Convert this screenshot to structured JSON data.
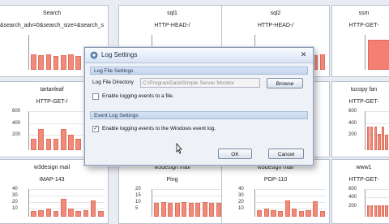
{
  "panels": [
    {
      "title": "Search",
      "subtitle": "&search_adv=0&search_size=&search_s",
      "ticks": [],
      "values": [
        0.45,
        0.42,
        0.44,
        0.4,
        0.42,
        0.45,
        0.4,
        0.44,
        0.42,
        0.43
      ]
    },
    {
      "title": "sql1",
      "subtitle": "HTTP-HEAD-/",
      "ticks": [],
      "values": [
        0.45,
        0.43,
        0.45,
        0.44,
        0.45,
        0.43,
        0.44,
        0.45,
        0.44,
        0.45
      ]
    },
    {
      "title": "sql2",
      "subtitle": "HTTP-HEAD-/",
      "ticks": [],
      "values": [
        0.45,
        0.43,
        0.42,
        0.44,
        0.45,
        0.43,
        0.45,
        0.44,
        0.43,
        0.44
      ]
    },
    {
      "title": "ssm",
      "subtitle": "HTTP-GET-",
      "ticks": [],
      "values": [
        0.85
      ]
    },
    {
      "title": "tartanleaf",
      "subtitle": "HTTP-GET-/",
      "ticks": [
        "600",
        "400",
        "200"
      ],
      "values": [
        0.3,
        0.55,
        0.3,
        0.3,
        0.55,
        0.4,
        0.3,
        0.35,
        0.25,
        0.3
      ]
    },
    {
      "title": "",
      "subtitle": "",
      "ticks": [],
      "values": []
    },
    {
      "title": "",
      "subtitle": "",
      "ticks": [],
      "values": []
    },
    {
      "title": "tucopy fan",
      "subtitle": "HTTP-GET-",
      "ticks": [
        "600",
        "400",
        "200"
      ],
      "values": [
        0.6,
        0.6,
        0.6,
        0.42,
        0.6,
        0.4,
        0.35
      ]
    },
    {
      "title": "w3design mail",
      "subtitle": "IMAP-143",
      "ticks": [
        "40",
        "30",
        "20",
        "10"
      ],
      "values": [
        0.2,
        0.25,
        0.3,
        0.2,
        0.65,
        0.3,
        0.2,
        0.25,
        0.6,
        0.2
      ]
    },
    {
      "title": "w3design mail",
      "subtitle": "Ping",
      "ticks": [
        "20",
        "15",
        "10",
        "5"
      ],
      "values": [
        0.5,
        0.52,
        0.5,
        0.5,
        0.52,
        0.5,
        0.5,
        0.52,
        0.5,
        0.5
      ]
    },
    {
      "title": "w3design mail",
      "subtitle": "POP-110",
      "ticks": [
        "40",
        "30",
        "20",
        "10"
      ],
      "values": [
        0.25,
        0.3,
        0.25,
        0.2,
        0.6,
        0.3,
        0.2,
        0.25,
        0.55,
        0.2
      ]
    },
    {
      "title": "www1",
      "subtitle": "HTTP-GET-",
      "ticks": [
        "600",
        "400",
        "200"
      ],
      "values": [
        0.4,
        0.42,
        0.42,
        0.42,
        0.42,
        0.4,
        0.4
      ]
    }
  ],
  "dialog": {
    "title": "Log Settings",
    "close_glyph": "✕",
    "file_section": "Log File Settings",
    "dir_label": "Log File Directory",
    "dir_value": "C:\\ProgramData\\Simple Server Monitor",
    "browse_label": "Browse",
    "file_checkbox_label": "Enable logging events to a file.",
    "file_checkbox_checked": false,
    "event_section": "Event Log Settings",
    "event_checkbox_label": "Enable logging events to the Windows event log.",
    "event_checkbox_checked": true,
    "ok_label": "OK",
    "cancel_label": "Cancel"
  },
  "colors": {
    "bar": "#f08b7a",
    "accent": "#c6d6ee"
  },
  "icons": {
    "app": "gear-icon",
    "close": "close-icon",
    "cursor": "mouse-cursor-icon"
  }
}
